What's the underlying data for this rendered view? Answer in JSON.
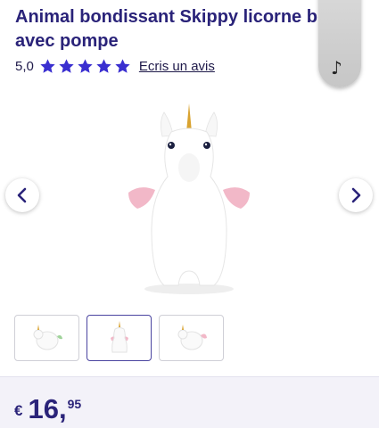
{
  "product": {
    "title": "Animal bondissant Skippy licorne blanc avec pompe"
  },
  "rating": {
    "value": "5,0",
    "stars": 5,
    "review_link": "Ecris un avis"
  },
  "gallery": {
    "thumbnail_count": 3,
    "active_thumbnail": 2
  },
  "price": {
    "currency": "€",
    "integer": "16,",
    "decimal": "95"
  },
  "icons": {
    "music": "music-note-icon",
    "prev": "chevron-left-icon",
    "next": "chevron-right-icon",
    "star": "star-icon"
  },
  "colors": {
    "brand": "#2a2379",
    "star": "#3a2fd0",
    "price_bar": "#f3f2f9"
  }
}
